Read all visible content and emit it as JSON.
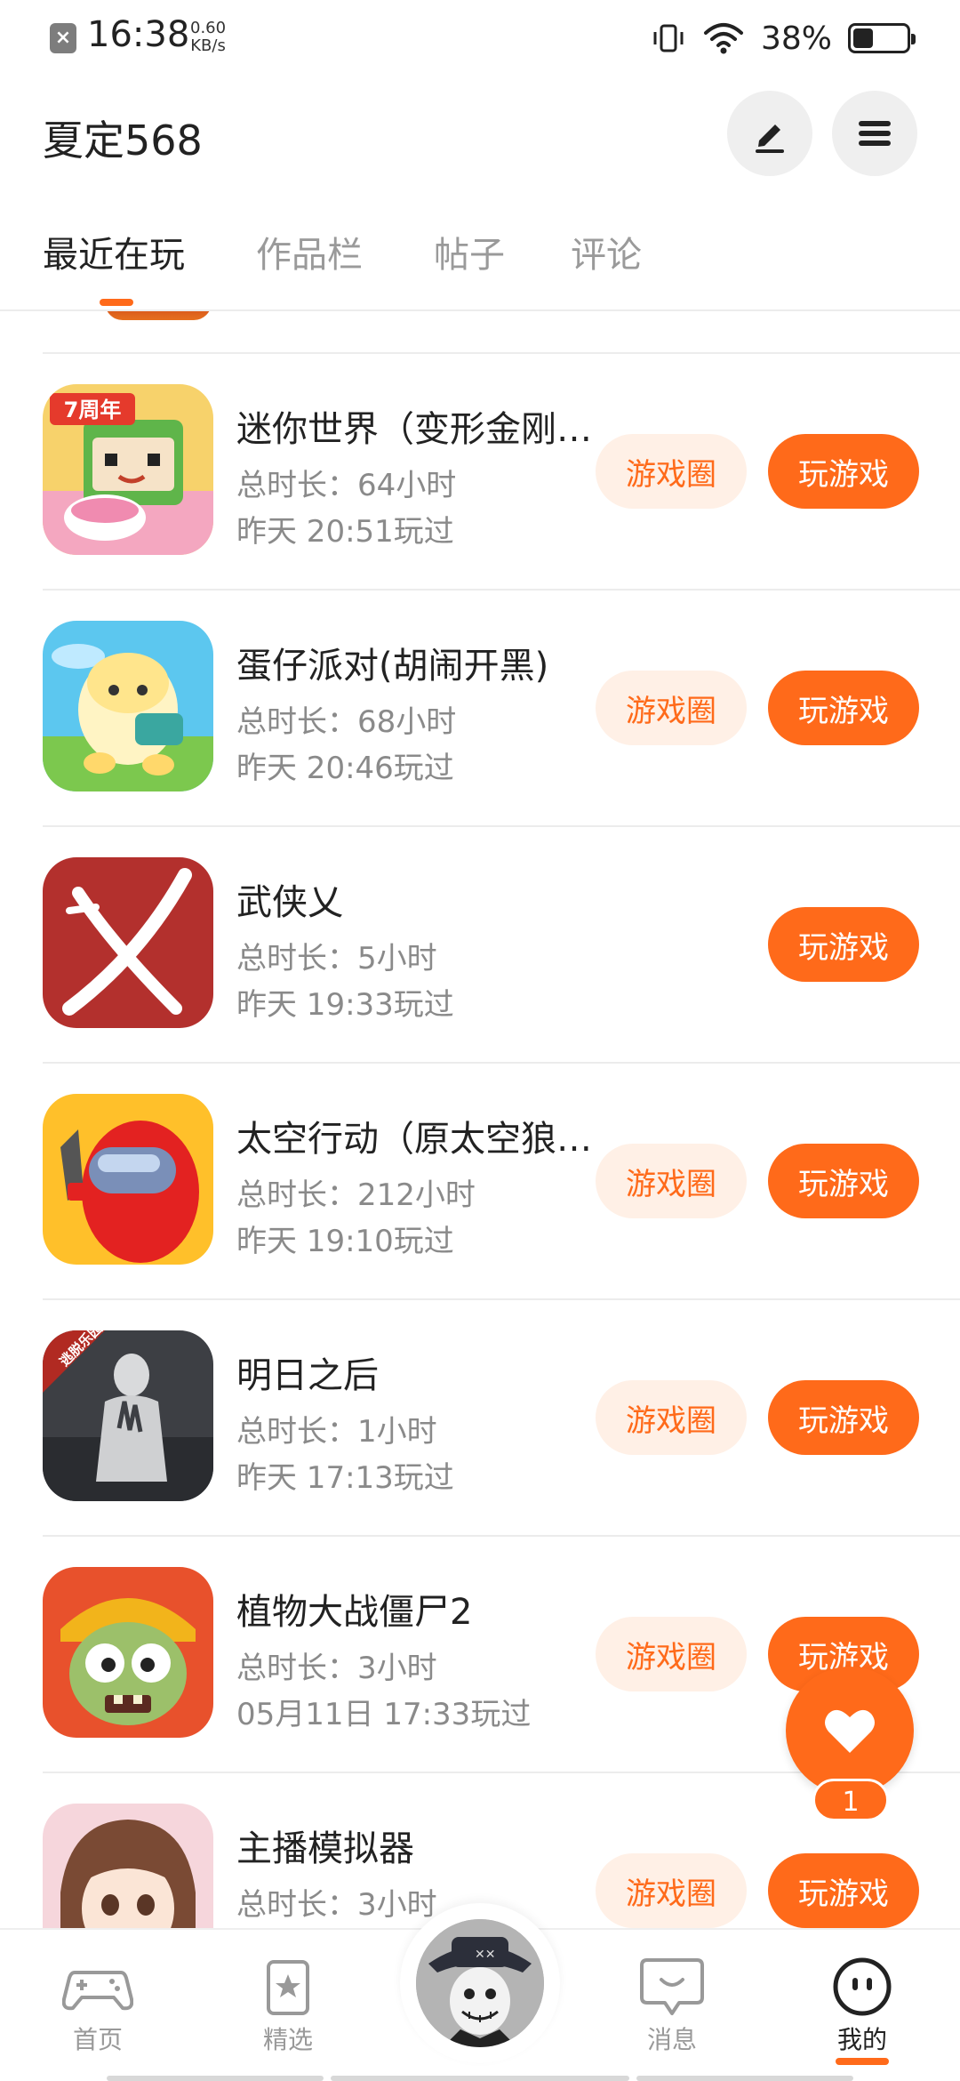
{
  "status_bar": {
    "time": "16:38",
    "speed_value": "0.60",
    "speed_unit": "KB/s",
    "battery_percent": "38%",
    "battery_level": 0.38
  },
  "header": {
    "username": "夏定568",
    "edit_icon": "pen-icon",
    "menu_icon": "menu-icon"
  },
  "tabs": [
    {
      "label": "最近在玩",
      "active": true
    },
    {
      "label": "作品栏",
      "active": false
    },
    {
      "label": "帖子",
      "active": false
    },
    {
      "label": "评论",
      "active": false
    }
  ],
  "buttons": {
    "circle_label": "游戏圈",
    "play_label": "玩游戏"
  },
  "games": [
    {
      "title": "迷你世界（变形金刚联动）",
      "duration": "总时长：64小时",
      "last_played": "昨天 20:51玩过",
      "has_circle": true,
      "icon_badge": "7周年"
    },
    {
      "title": "蛋仔派对(胡闹开黑)",
      "duration": "总时长：68小时",
      "last_played": "昨天 20:46玩过",
      "has_circle": true
    },
    {
      "title": "武侠乂",
      "duration": "总时长：5小时",
      "last_played": "昨天 19:33玩过",
      "has_circle": false
    },
    {
      "title": "太空行动（原太空狼人杀）",
      "duration": "总时长：212小时",
      "last_played": "昨天 19:10玩过",
      "has_circle": true
    },
    {
      "title": "明日之后",
      "duration": "总时长：1小时",
      "last_played": "昨天 17:13玩过",
      "has_circle": true,
      "icon_badge": "逃脱乐园"
    },
    {
      "title": "植物大战僵尸2",
      "duration": "总时长：3小时",
      "last_played": "05月11日 17:33玩过",
      "has_circle": true
    },
    {
      "title": "主播模拟器",
      "duration": "总时长：3小时",
      "last_played": "",
      "has_circle": true
    }
  ],
  "fab": {
    "icon": "heart-icon",
    "count": "1"
  },
  "bottom_nav": [
    {
      "label": "首页",
      "icon": "gamepad-icon",
      "active": false
    },
    {
      "label": "精选",
      "icon": "star-icon",
      "active": false
    },
    {
      "label": "",
      "icon": "avatar",
      "active": false
    },
    {
      "label": "消息",
      "icon": "message-icon",
      "active": false
    },
    {
      "label": "我的",
      "icon": "profile-icon",
      "active": true
    }
  ],
  "colors": {
    "accent": "#ff6a1a",
    "accent_light": "#fff0e6",
    "text_primary": "#222222",
    "text_secondary": "#8a8a8a"
  }
}
